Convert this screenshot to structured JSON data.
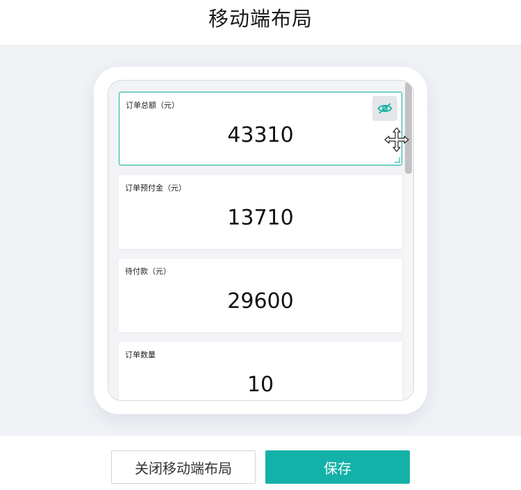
{
  "header": {
    "title": "移动端布局"
  },
  "cards": [
    {
      "label": "订单总额（元）",
      "value": "43310",
      "selected": true
    },
    {
      "label": "订单预付金（元）",
      "value": "13710"
    },
    {
      "label": "待付款（元）",
      "value": "29600"
    },
    {
      "label": "订单数量",
      "value": "10"
    }
  ],
  "icons": {
    "visibility_toggle": "eye-off-icon",
    "drag_cursor": "move-icon"
  },
  "footer": {
    "close_label": "关闭移动端布局",
    "save_label": "保存"
  },
  "colors": {
    "accent": "#14b1a8",
    "stage_background": "#f0f2f6"
  }
}
